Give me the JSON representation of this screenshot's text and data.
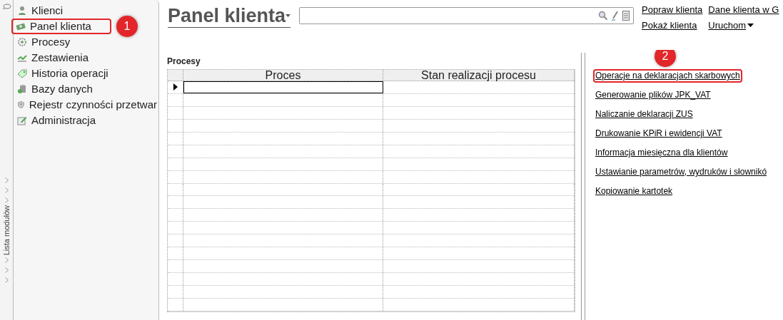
{
  "module_strip": {
    "label": "Lista modułów"
  },
  "sidebar": {
    "items": [
      {
        "label": "Klienci",
        "selected": false
      },
      {
        "label": "Panel klienta",
        "selected": true
      },
      {
        "label": "Procesy",
        "selected": false
      },
      {
        "label": "Zestawienia",
        "selected": false
      },
      {
        "label": "Historia operacji",
        "selected": false
      },
      {
        "label": "Bazy danych",
        "selected": false
      },
      {
        "label": "Rejestr czynności przetwar",
        "selected": false
      },
      {
        "label": "Administracja",
        "selected": false
      }
    ]
  },
  "header": {
    "title": "Panel klienta",
    "top_links": [
      {
        "label": "Popraw klienta",
        "dropdown": false
      },
      {
        "label": "Dane klienta w G",
        "dropdown": false
      },
      {
        "label": "Pokaż klienta",
        "dropdown": false
      },
      {
        "label": "Uruchom",
        "dropdown": true
      }
    ]
  },
  "processes": {
    "title": "Procesy",
    "columns": [
      "Proces",
      "Stan realizacji procesu"
    ],
    "rows": [
      {
        "current": true
      },
      {
        "current": false
      },
      {
        "current": false
      },
      {
        "current": false
      },
      {
        "current": false
      },
      {
        "current": false
      },
      {
        "current": false
      },
      {
        "current": false
      },
      {
        "current": false
      },
      {
        "current": false
      },
      {
        "current": false
      },
      {
        "current": false
      },
      {
        "current": false
      },
      {
        "current": false
      },
      {
        "current": false
      },
      {
        "current": false
      },
      {
        "current": false
      },
      {
        "current": false
      }
    ]
  },
  "actions": [
    {
      "label": "Operacje na deklaracjach skarbowych",
      "highlighted": true
    },
    {
      "label": "Generowanie plików JPK_VAT",
      "highlighted": false
    },
    {
      "label": "Naliczanie deklaracji ZUS",
      "highlighted": false
    },
    {
      "label": "Drukowanie KPiR i ewidencji VAT",
      "highlighted": false
    },
    {
      "label": "Informacja miesięczna dla klientów",
      "highlighted": false
    },
    {
      "label": "Ustawianie parametrów, wydruków i słownikó",
      "highlighted": false
    },
    {
      "label": "Kopiowanie kartotek",
      "highlighted": false
    }
  ],
  "callouts": [
    "1",
    "2"
  ]
}
